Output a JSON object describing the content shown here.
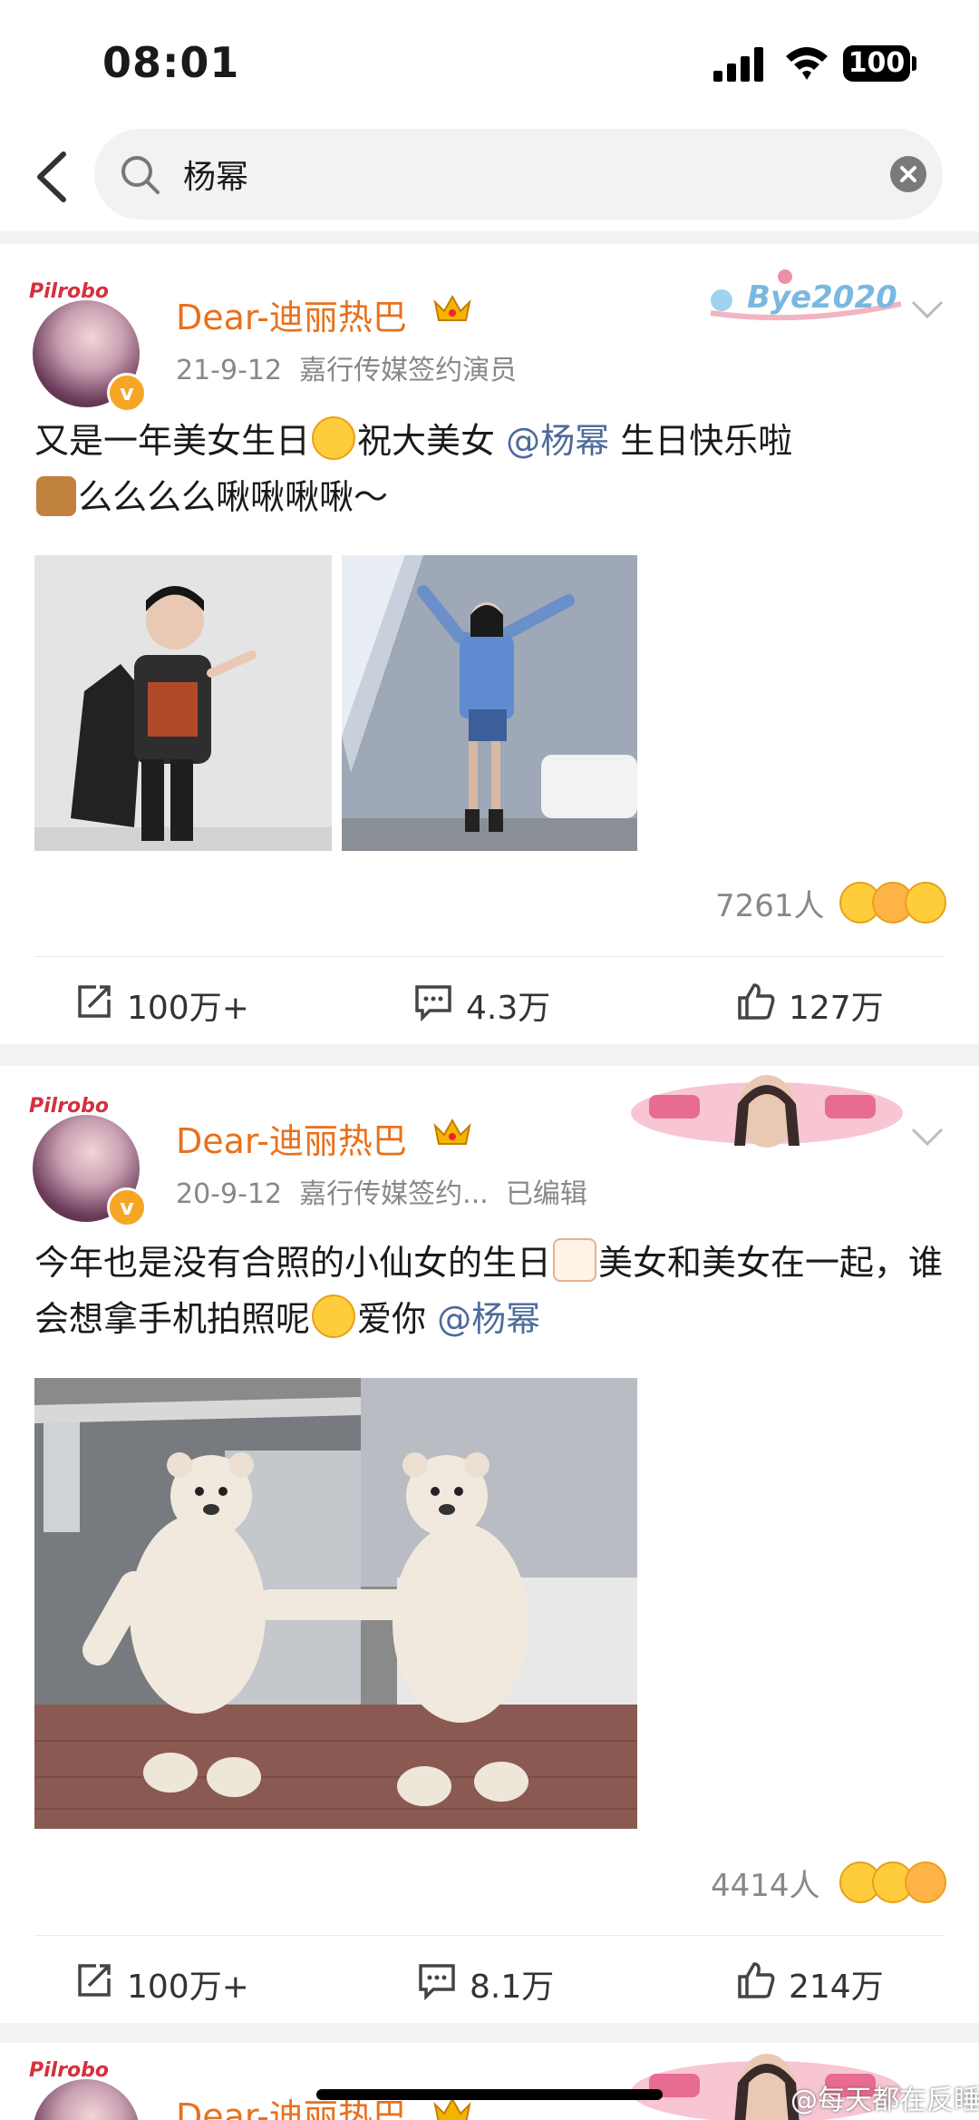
{
  "status": {
    "time": "08:01",
    "battery": "100"
  },
  "search": {
    "query": "杨幂"
  },
  "posts": [
    {
      "username": "Dear-迪丽热巴",
      "date": "21-9-12",
      "source": "嘉行传媒签约演员",
      "text_a": "又是一年美女生日",
      "text_b": "祝大美女",
      "mention": "@杨幂",
      "text_c": " 生日快乐啦",
      "text_d": "么么么么啾啾啾啾～",
      "reactions": "7261人",
      "repost": "100万+",
      "comments": "4.3万",
      "likes": "127万"
    },
    {
      "username": "Dear-迪丽热巴",
      "date": "20-9-12",
      "source": "嘉行传媒签约...",
      "edited": "已编辑",
      "text_a": "今年也是没有合照的小仙女的生日",
      "text_b": "美女和美女在一起，谁会想拿手机拍照呢",
      "text_c": "爱你 ",
      "mention": "@杨幂",
      "reactions": "4414人",
      "repost": "100万+",
      "comments": "8.1万",
      "likes": "214万"
    },
    {
      "username": "Dear-迪丽热巴"
    }
  ],
  "watermark": "@每天都在反睡"
}
